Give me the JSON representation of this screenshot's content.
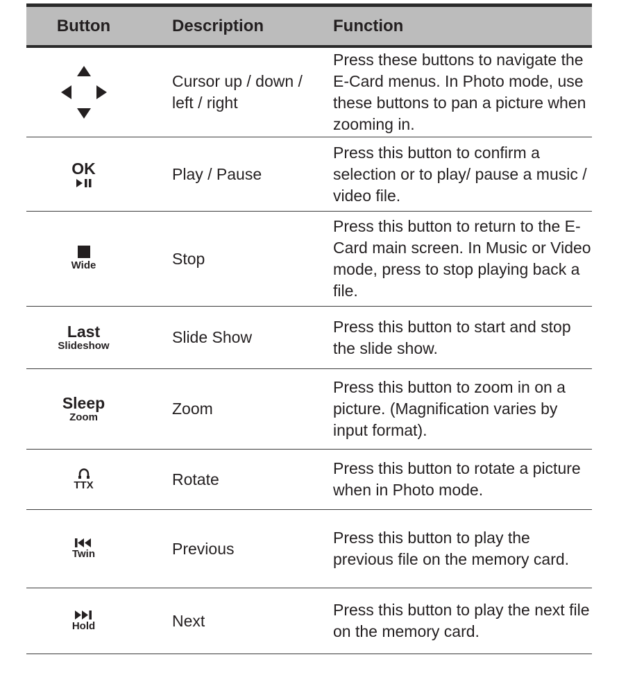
{
  "header": {
    "button": "Button",
    "description": "Description",
    "function": "Function"
  },
  "rows": [
    {
      "icon": "cursor-arrows-icon",
      "main": "",
      "sub": "",
      "description": "Cursor up / down / left / right",
      "function": "Press these buttons to navigate the E-Card menus. In Photo mode, use these buttons to pan a picture when zooming in."
    },
    {
      "icon": "play-pause-icon",
      "main": "OK",
      "sub": "",
      "description": "Play / Pause",
      "function": "Press this button to confirm a selection or to play/ pause a music / video file."
    },
    {
      "icon": "stop-icon",
      "main": "",
      "sub": "Wide",
      "description": "Stop",
      "function": "Press this button to return to the E-Card main screen. In Music or Video mode, press to stop playing back a file."
    },
    {
      "icon": "",
      "main": "Last",
      "sub": "Slideshow",
      "description": "Slide Show",
      "function": "Press this button to start and stop the slide show."
    },
    {
      "icon": "",
      "main": "Sleep",
      "sub": "Zoom",
      "description": "Zoom",
      "function": "Press this button to zoom in on a picture. (Magnification varies by input format)."
    },
    {
      "icon": "rotate-icon",
      "main": "",
      "sub": "TTX",
      "description": "Rotate",
      "function": "Press this button to rotate a picture when in Photo mode."
    },
    {
      "icon": "previous-icon",
      "main": "",
      "sub": "Twin",
      "description": "Previous",
      "function": "Press this button to play the previous file on the memory card."
    },
    {
      "icon": "next-icon",
      "main": "",
      "sub": "Hold",
      "description": "Next",
      "function": "Press this button to play the next file on the memory card."
    }
  ]
}
